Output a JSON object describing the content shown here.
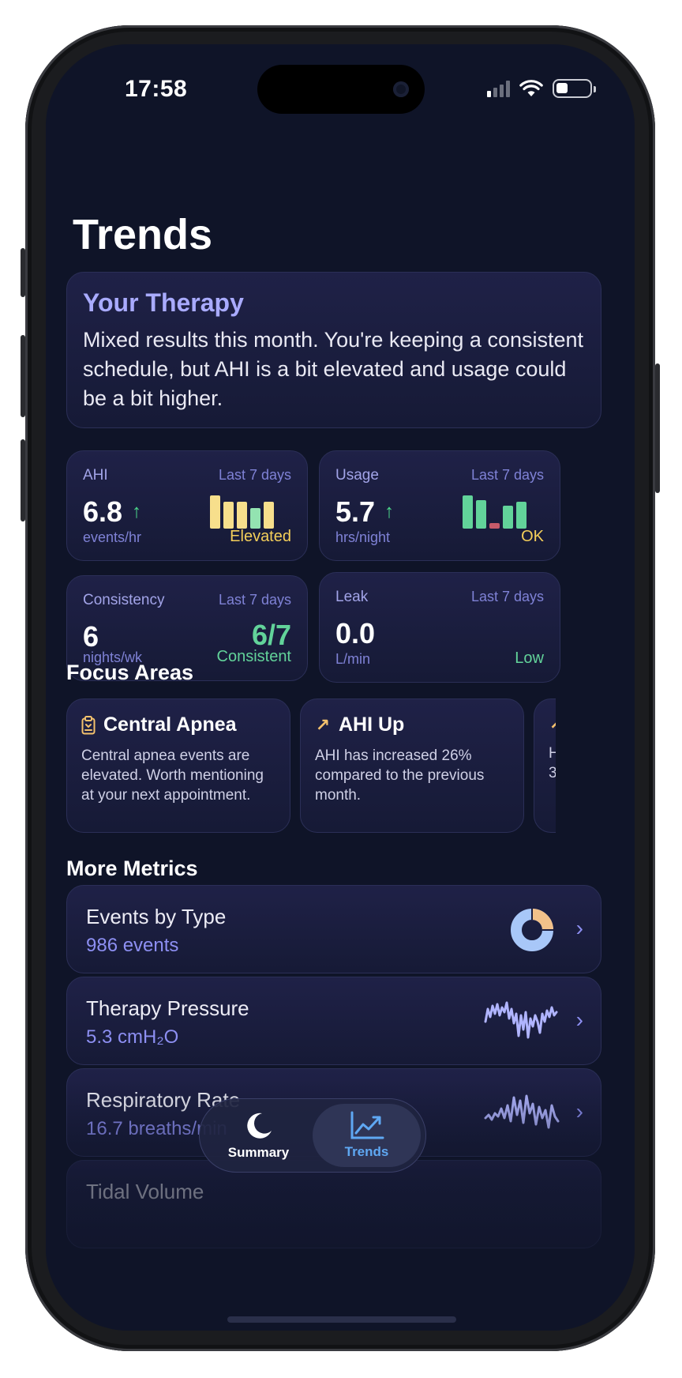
{
  "status_bar": {
    "time": "17:58"
  },
  "page": {
    "title": "Trends"
  },
  "therapy": {
    "title": "Your Therapy",
    "body": "Mixed results this month. You're keeping a consistent schedule, but AHI is a bit elevated and usage could be a bit higher."
  },
  "metrics": [
    {
      "label": "AHI",
      "period": "Last 7 days",
      "value": "6.8",
      "arrow": "↑",
      "unit": "events/hr",
      "status": "Elevated",
      "status_color": "#f4cf5a",
      "bars": [
        1.0,
        0.82,
        0.82,
        0.63,
        0.82
      ],
      "bar_colors": [
        "#f7df8c",
        "#f7df8c",
        "#f7df8c",
        "#93e3b1",
        "#f7df8c"
      ]
    },
    {
      "label": "Usage",
      "period": "Last 7 days",
      "value": "5.7",
      "arrow": "↑",
      "unit": "hrs/night",
      "status": "OK",
      "status_color": "#f4cf5a",
      "bars": [
        1.0,
        0.85,
        0.17,
        0.68,
        0.8
      ],
      "bar_colors": [
        "#62d39a",
        "#62d39a",
        "#c65a6a",
        "#62d39a",
        "#62d39a"
      ]
    },
    {
      "label": "Consistency",
      "period": "Last 7 days",
      "value": "6",
      "big": "6/7",
      "unit": "nights/wk",
      "status": "Consistent",
      "status_color": "#62d39a"
    },
    {
      "label": "Leak",
      "period": "Last 7 days",
      "value": "0.0",
      "unit": "L/min",
      "status": "Low",
      "status_color": "#62d39a"
    }
  ],
  "focus": {
    "title": "Focus Areas",
    "items": [
      {
        "icon": "clipboard-icon",
        "title": "Central Apnea",
        "body": "Central apnea events are elevated. Worth mentioning at your next appointment."
      },
      {
        "icon": "trend-up-arrow-icon",
        "title": "AHI Up",
        "body": "AHI has increased 26% compared to the previous month."
      },
      {
        "icon": "trend-up-arrow-icon",
        "title": "",
        "body": "H\n3"
      }
    ]
  },
  "more_metrics": {
    "title": "More Metrics",
    "rows": [
      {
        "title": "Events by Type",
        "value": "986 events",
        "visual": "donut",
        "donut_fraction_accent": 0.25
      },
      {
        "title": "Therapy Pressure",
        "value": "5.3 cmH₂O",
        "visual": "sparkline"
      },
      {
        "title": "Respiratory Rate",
        "value": "16.7 breaths/min",
        "visual": "sparkline"
      },
      {
        "title": "Tidal Volume",
        "value": "",
        "visual": "sparkline"
      }
    ]
  },
  "tabbar": {
    "tabs": [
      {
        "label": "Summary",
        "icon": "moon-icon",
        "active": false
      },
      {
        "label": "Trends",
        "icon": "chart-icon",
        "active": true
      }
    ]
  },
  "colors": {
    "background": "#0f1428",
    "card": "#1b1d3f",
    "accent": "#a9abff",
    "positive": "#62d39a",
    "warning": "#f4cf5a"
  }
}
